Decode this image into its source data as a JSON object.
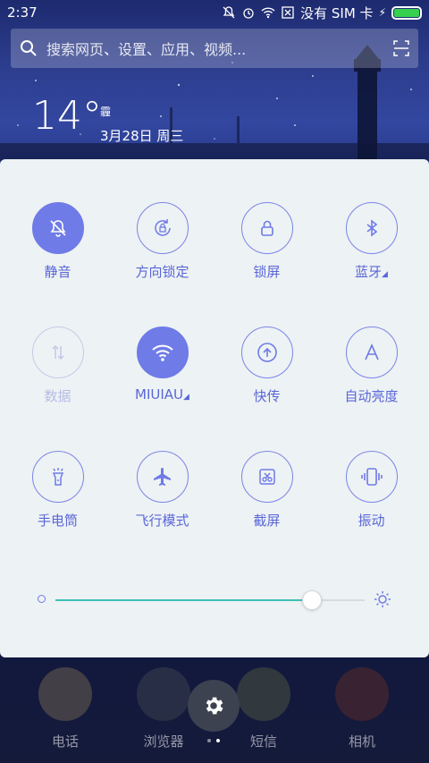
{
  "status_bar": {
    "time": "2:37",
    "carrier": "没有 SIM 卡",
    "battery_level": 1.0,
    "battery_color": "#35d04f"
  },
  "search": {
    "placeholder": "搜索网页、设置、应用、视频...",
    "icon": "search-icon",
    "scan_icon": "scan-icon"
  },
  "weather": {
    "temperature": "14°",
    "condition": "霾",
    "date": "3月28日 周三"
  },
  "quick_settings": [
    {
      "label": "静音",
      "icon": "bell-off-icon",
      "state": "active"
    },
    {
      "label": "方向锁定",
      "icon": "rotation-lock-icon",
      "state": "inactive"
    },
    {
      "label": "锁屏",
      "icon": "lock-icon",
      "state": "inactive"
    },
    {
      "label": "蓝牙",
      "icon": "bluetooth-icon",
      "state": "inactive",
      "has_more": true
    },
    {
      "label": "数据",
      "icon": "data-icon",
      "state": "disabled"
    },
    {
      "label": "MIUIAU",
      "icon": "wifi-icon",
      "state": "active",
      "has_more": true
    },
    {
      "label": "快传",
      "icon": "upload-icon",
      "state": "inactive"
    },
    {
      "label": "自动亮度",
      "icon": "auto-brightness-icon",
      "state": "inactive"
    },
    {
      "label": "手电筒",
      "icon": "flashlight-icon",
      "state": "inactive"
    },
    {
      "label": "飞行模式",
      "icon": "airplane-icon",
      "state": "inactive"
    },
    {
      "label": "截屏",
      "icon": "screenshot-icon",
      "state": "inactive"
    },
    {
      "label": "振动",
      "icon": "vibrate-icon",
      "state": "inactive"
    }
  ],
  "brightness": {
    "level": 0.83,
    "accent": "#3ec1b6"
  },
  "dock": [
    {
      "label": "电话",
      "icon": "phone-app-icon"
    },
    {
      "label": "浏览器",
      "icon": "browser-app-icon"
    },
    {
      "label": "短信",
      "icon": "messages-app-icon"
    },
    {
      "label": "相机",
      "icon": "camera-app-icon"
    }
  ],
  "accent_color": "#6f7be6"
}
